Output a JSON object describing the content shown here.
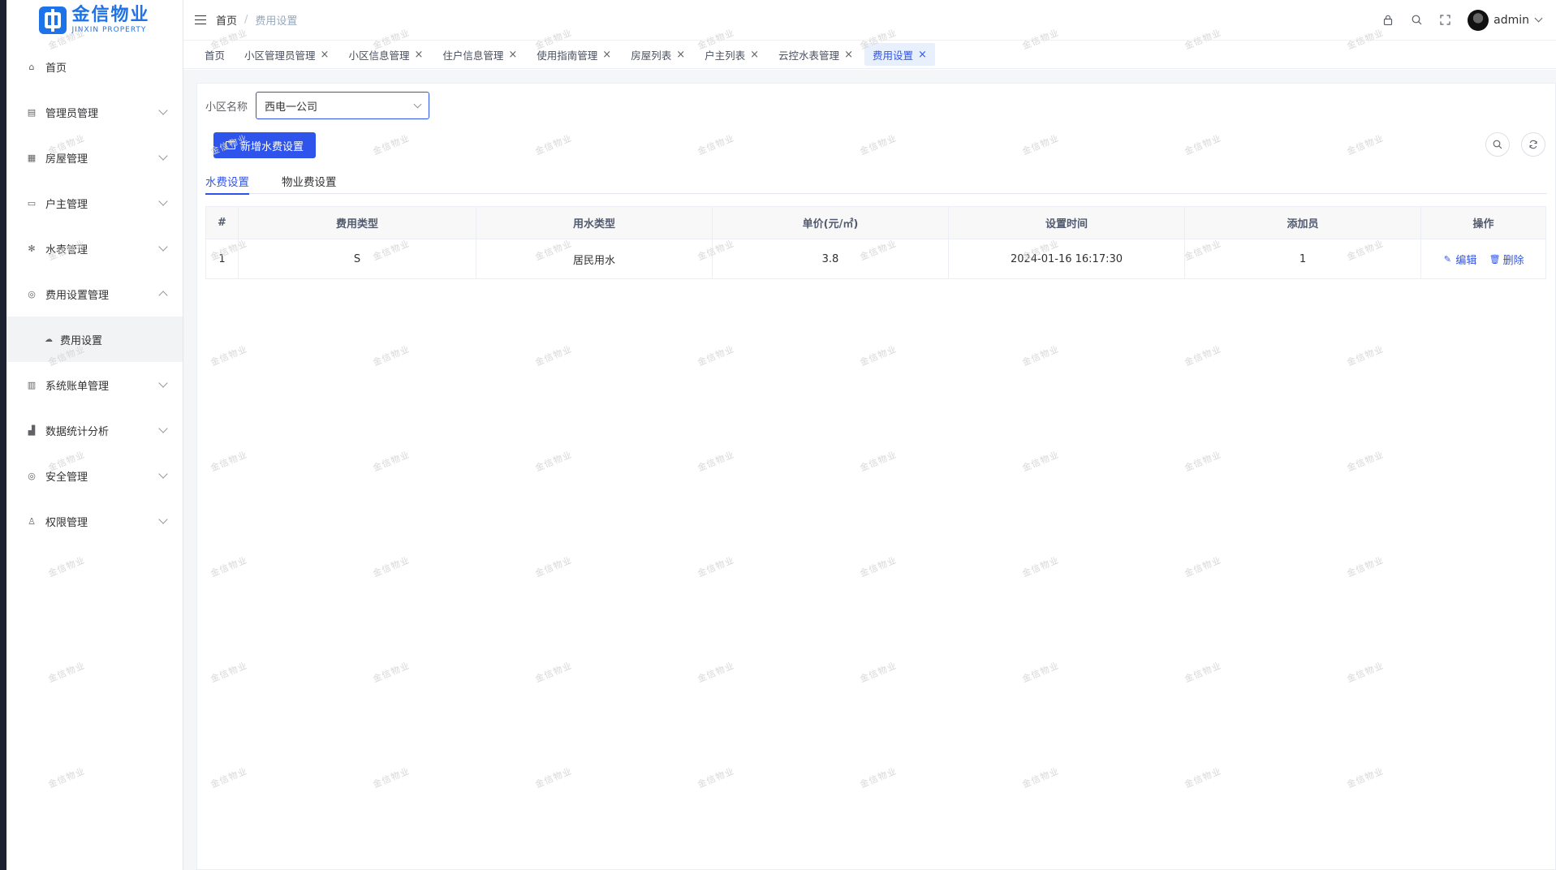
{
  "logo": {
    "cn": "金信物业",
    "en": "JINXIN PROPERTY"
  },
  "sidebar": {
    "items": [
      {
        "label": "首页",
        "icon": "home-icon",
        "has_children": false
      },
      {
        "label": "管理员管理",
        "icon": "admin-icon",
        "has_children": true
      },
      {
        "label": "房屋管理",
        "icon": "grid-icon",
        "has_children": true
      },
      {
        "label": "户主管理",
        "icon": "monitor-icon",
        "has_children": true
      },
      {
        "label": "水表管理",
        "icon": "fan-icon",
        "has_children": true
      },
      {
        "label": "费用设置管理",
        "icon": "settings-icon",
        "has_children": true,
        "expanded": true
      },
      {
        "label": "系统账单管理",
        "icon": "book-icon",
        "has_children": true
      },
      {
        "label": "数据统计分析",
        "icon": "chart-icon",
        "has_children": true
      },
      {
        "label": "安全管理",
        "icon": "security-icon",
        "has_children": true
      },
      {
        "label": "权限管理",
        "icon": "user-icon",
        "has_children": true
      }
    ],
    "sub_item": {
      "label": "费用设置",
      "icon": "cloud-icon"
    }
  },
  "header": {
    "breadcrumb": [
      "首页",
      "费用设置"
    ],
    "separator": "/",
    "username": "admin"
  },
  "tags": [
    {
      "label": "首页",
      "closable": false,
      "active": false
    },
    {
      "label": "小区管理员管理",
      "closable": true,
      "active": false
    },
    {
      "label": "小区信息管理",
      "closable": true,
      "active": false
    },
    {
      "label": "住户信息管理",
      "closable": true,
      "active": false
    },
    {
      "label": "使用指南管理",
      "closable": true,
      "active": false
    },
    {
      "label": "房屋列表",
      "closable": true,
      "active": false
    },
    {
      "label": "户主列表",
      "closable": true,
      "active": false
    },
    {
      "label": "云控水表管理",
      "closable": true,
      "active": false
    },
    {
      "label": "费用设置",
      "closable": true,
      "active": true
    }
  ],
  "filter": {
    "label": "小区名称",
    "value": "西电一公司"
  },
  "add_button": "新增水费设置",
  "tabs": [
    {
      "label": "水费设置",
      "active": true
    },
    {
      "label": "物业费设置",
      "active": false
    }
  ],
  "table": {
    "columns": [
      "#",
      "费用类型",
      "用水类型",
      "单价(元/㎡)",
      "设置时间",
      "添加员",
      "操作"
    ],
    "rows": [
      {
        "index": "1",
        "fee_type": "S",
        "water_type": "居民用水",
        "price": "3.8",
        "time": "2024-01-16 16:17:30",
        "operator": "1"
      }
    ],
    "actions": {
      "edit": "编辑",
      "delete": "删除"
    }
  },
  "watermark": "金信物业",
  "colors": {
    "primary": "#2f54eb",
    "logo": "#1e73e8"
  }
}
